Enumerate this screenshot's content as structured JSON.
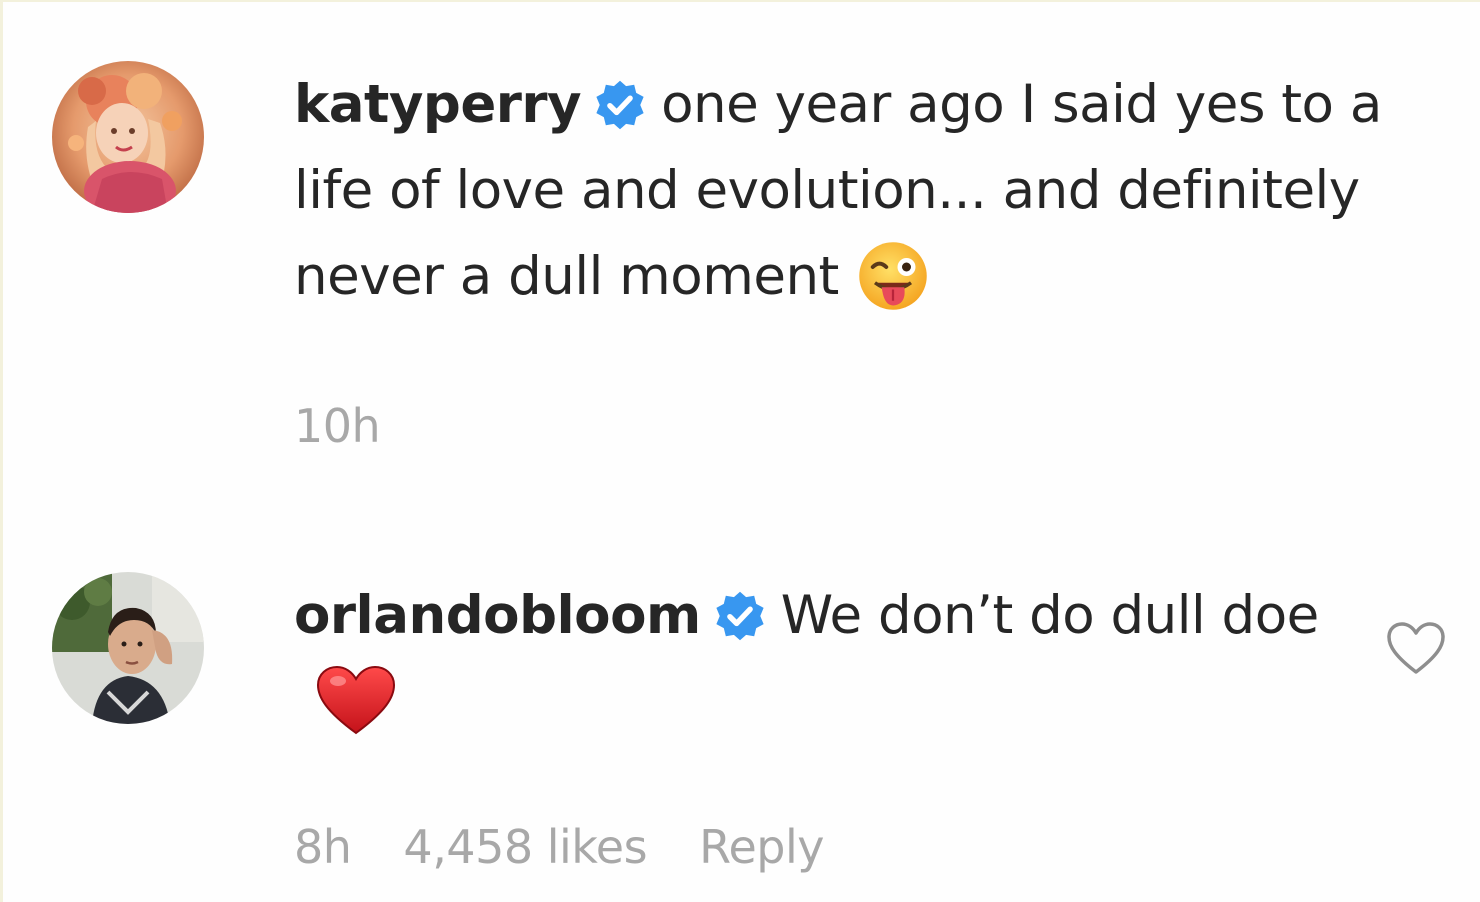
{
  "comments": [
    {
      "username": "katyperry",
      "verified_icon": "verified-badge-icon",
      "text": "one year ago I said yes to a life of love and evolution... and definitely never a dull moment",
      "emoji": "winking-face-with-tongue-emoji",
      "time": "10h"
    },
    {
      "username": "orlandobloom",
      "verified_icon": "verified-badge-icon",
      "text": "We don’t do dull doe",
      "emoji": "red-heart-emoji",
      "time": "8h",
      "likes": "4,458 likes",
      "reply_label": "Reply",
      "like_icon": "heart-outline-icon"
    }
  ],
  "colors": {
    "text": "#262626",
    "meta": "#a8a8a8",
    "verified": "#3897f0",
    "heart_red": "#e0242c"
  }
}
